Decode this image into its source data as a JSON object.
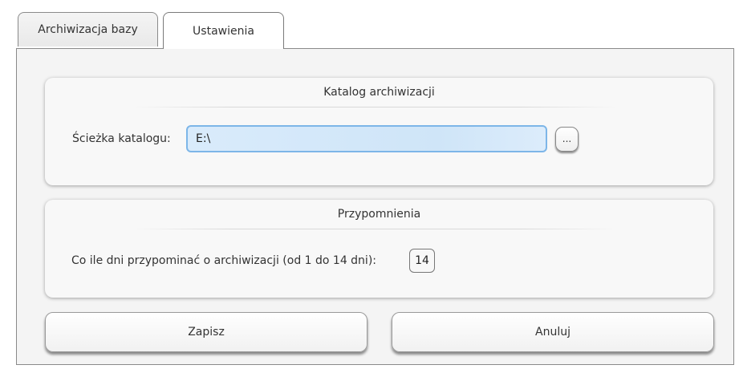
{
  "tabs": [
    {
      "label": "Archiwizacja bazy",
      "active": false
    },
    {
      "label": "Ustawienia",
      "active": true
    }
  ],
  "archive_dir": {
    "title": "Katalog archiwizacji",
    "path_label": "Ścieżka katalogu:",
    "path_value": "E:\\",
    "browse_label": "..."
  },
  "reminders": {
    "title": "Przypomnienia",
    "days_label": "Co ile dni przypominać o archiwizacji (od 1 do 14 dni):",
    "days_value": "14"
  },
  "actions": {
    "save_label": "Zapisz",
    "cancel_label": "Anuluj"
  },
  "colors": {
    "input_focus_border": "#7db6e8",
    "input_focus_bg": "#d9ebfb"
  }
}
